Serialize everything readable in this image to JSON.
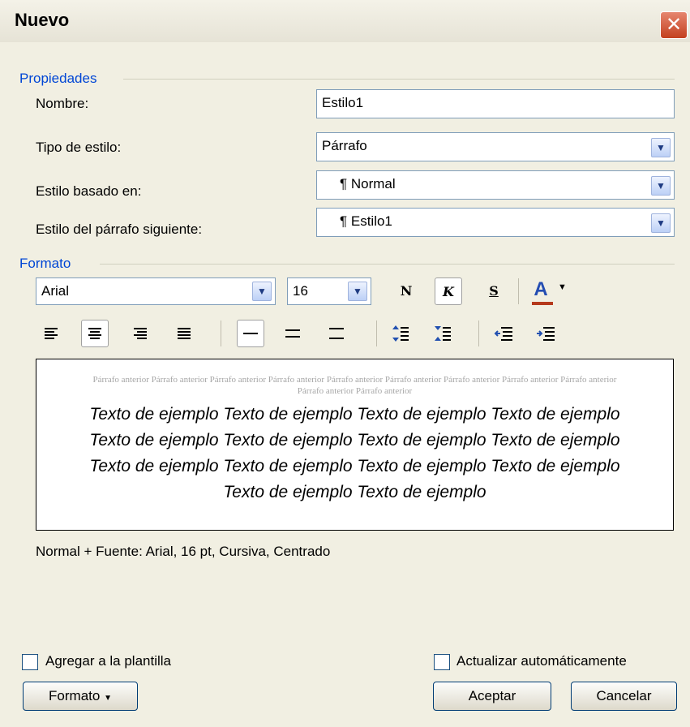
{
  "dialog": {
    "title": "Nuevo"
  },
  "propiedades": {
    "group_label": "Propiedades",
    "nombre_label": "Nombre:",
    "nombre_value": "Estilo1",
    "tipo_label": "Tipo de estilo:",
    "tipo_value": "Párrafo",
    "basado_label": "Estilo basado en:",
    "basado_value": "¶ Normal",
    "siguiente_label": "Estilo del párrafo siguiente:",
    "siguiente_value": "¶ Estilo1"
  },
  "formato": {
    "group_label": "Formato",
    "font_value": "Arial",
    "size_value": "16",
    "bold_label": "N",
    "italic_label": "K",
    "underline_label": "S",
    "color_label": "A",
    "accent_color": "#b5391c"
  },
  "preview": {
    "previous_paragraph": "Párrafo anterior Párrafo anterior Párrafo anterior Párrafo anterior Párrafo anterior Párrafo anterior Párrafo anterior Párrafo anterior Párrafo anterior Párrafo anterior Párrafo anterior",
    "sample_text": "Texto de ejemplo Texto de ejemplo Texto de ejemplo Texto de ejemplo Texto de ejemplo Texto de ejemplo Texto de ejemplo Texto de ejemplo Texto de ejemplo Texto de ejemplo Texto de ejemplo Texto de ejemplo Texto de ejemplo Texto de ejemplo"
  },
  "description": "Normal + Fuente: Arial, 16 pt, Cursiva, Centrado",
  "options": {
    "add_template_label": "Agregar a la plantilla",
    "auto_update_label": "Actualizar automáticamente"
  },
  "buttons": {
    "formato_label": "Formato",
    "aceptar_label": "Aceptar",
    "cancelar_label": "Cancelar"
  },
  "icons": {
    "close": "close-icon",
    "dropdown": "chevron-down-icon"
  }
}
